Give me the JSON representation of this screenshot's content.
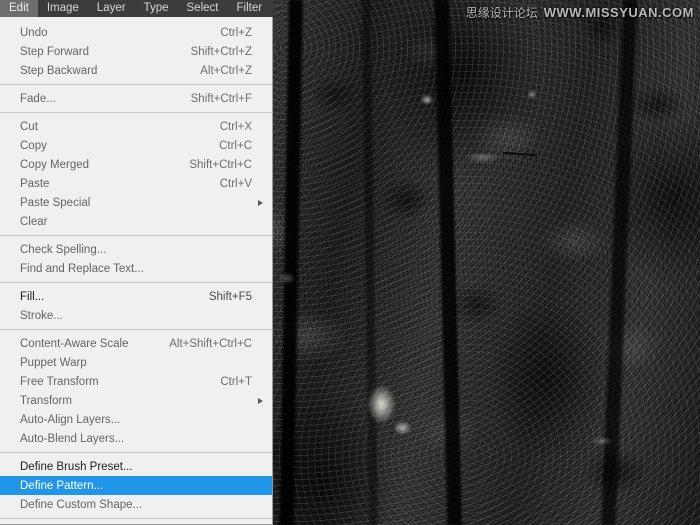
{
  "menubar": {
    "items": [
      {
        "label": "Edit",
        "active": true
      },
      {
        "label": "Image",
        "active": false
      },
      {
        "label": "Layer",
        "active": false
      },
      {
        "label": "Type",
        "active": false
      },
      {
        "label": "Select",
        "active": false
      },
      {
        "label": "Filter",
        "active": false
      }
    ]
  },
  "edit_menu": {
    "groups": [
      {
        "items": [
          {
            "label": "Undo",
            "shortcut": "Ctrl+Z",
            "enabled": false,
            "selected": false,
            "submenu": false
          },
          {
            "label": "Step Forward",
            "shortcut": "Shift+Ctrl+Z",
            "enabled": false,
            "selected": false,
            "submenu": false
          },
          {
            "label": "Step Backward",
            "shortcut": "Alt+Ctrl+Z",
            "enabled": false,
            "selected": false,
            "submenu": false
          }
        ]
      },
      {
        "items": [
          {
            "label": "Fade...",
            "shortcut": "Shift+Ctrl+F",
            "enabled": false,
            "selected": false,
            "submenu": false
          }
        ]
      },
      {
        "items": [
          {
            "label": "Cut",
            "shortcut": "Ctrl+X",
            "enabled": false,
            "selected": false,
            "submenu": false
          },
          {
            "label": "Copy",
            "shortcut": "Ctrl+C",
            "enabled": false,
            "selected": false,
            "submenu": false
          },
          {
            "label": "Copy Merged",
            "shortcut": "Shift+Ctrl+C",
            "enabled": false,
            "selected": false,
            "submenu": false
          },
          {
            "label": "Paste",
            "shortcut": "Ctrl+V",
            "enabled": false,
            "selected": false,
            "submenu": false
          },
          {
            "label": "Paste Special",
            "shortcut": "",
            "enabled": false,
            "selected": false,
            "submenu": true
          },
          {
            "label": "Clear",
            "shortcut": "",
            "enabled": false,
            "selected": false,
            "submenu": false
          }
        ]
      },
      {
        "items": [
          {
            "label": "Check Spelling...",
            "shortcut": "",
            "enabled": false,
            "selected": false,
            "submenu": false
          },
          {
            "label": "Find and Replace Text...",
            "shortcut": "",
            "enabled": false,
            "selected": false,
            "submenu": false
          }
        ]
      },
      {
        "items": [
          {
            "label": "Fill...",
            "shortcut": "Shift+F5",
            "enabled": true,
            "selected": false,
            "submenu": false
          },
          {
            "label": "Stroke...",
            "shortcut": "",
            "enabled": false,
            "selected": false,
            "submenu": false
          }
        ]
      },
      {
        "items": [
          {
            "label": "Content-Aware Scale",
            "shortcut": "Alt+Shift+Ctrl+C",
            "enabled": false,
            "selected": false,
            "submenu": false
          },
          {
            "label": "Puppet Warp",
            "shortcut": "",
            "enabled": false,
            "selected": false,
            "submenu": false
          },
          {
            "label": "Free Transform",
            "shortcut": "Ctrl+T",
            "enabled": false,
            "selected": false,
            "submenu": false
          },
          {
            "label": "Transform",
            "shortcut": "",
            "enabled": false,
            "selected": false,
            "submenu": true
          },
          {
            "label": "Auto-Align Layers...",
            "shortcut": "",
            "enabled": false,
            "selected": false,
            "submenu": false
          },
          {
            "label": "Auto-Blend Layers...",
            "shortcut": "",
            "enabled": false,
            "selected": false,
            "submenu": false
          }
        ]
      },
      {
        "items": [
          {
            "label": "Define Brush Preset...",
            "shortcut": "",
            "enabled": true,
            "selected": false,
            "submenu": false
          },
          {
            "label": "Define Pattern...",
            "shortcut": "",
            "enabled": true,
            "selected": true,
            "submenu": false
          },
          {
            "label": "Define Custom Shape...",
            "shortcut": "",
            "enabled": false,
            "selected": false,
            "submenu": false
          }
        ]
      },
      {
        "items": []
      }
    ]
  },
  "watermark": {
    "cn_text": "思缘设计论坛",
    "url_text": "WWW.MISSYUAN.COM"
  },
  "canvas": {
    "description": "grayscale rock texture photograph"
  },
  "colors": {
    "menubar_bg": "#3c3c3c",
    "menubar_active_bg": "#6e6e6e",
    "menu_bg": "#f0f0f0",
    "menu_text": "#1e1e1e",
    "menu_text_disabled": "#646464",
    "selection_blue": "#2196e8",
    "separator": "#c8c8c8"
  }
}
